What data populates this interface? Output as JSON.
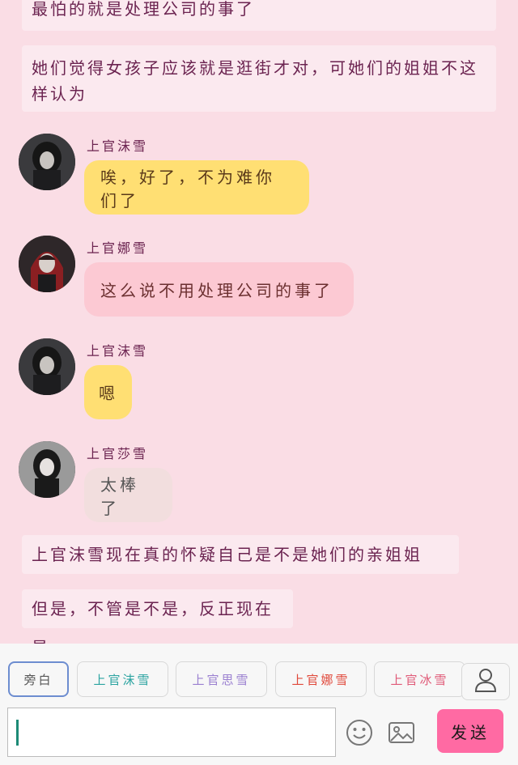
{
  "chat": {
    "narration_top_1": "最怕的就是处理公司的事了",
    "narration_top_2": "她们觉得女孩子应该就是逛街才对，可她们的姐姐不这样认为",
    "messages": [
      {
        "name": "上官沫雪",
        "text": "唉，好了，不为难你们了",
        "style": "yellow"
      },
      {
        "name": "上官娜雪",
        "text": "这么说不用处理公司的事了",
        "style": "pink"
      },
      {
        "name": "上官沫雪",
        "text": "嗯",
        "style": "yellow"
      },
      {
        "name": "上官莎雪",
        "text": "太棒了",
        "style": "beige"
      }
    ],
    "narration_bottom_1": "上官沫雪现在真的怀疑自己是不是她们的亲姐姐",
    "narration_bottom_2": "但是，不管是不是，反正现在是"
  },
  "toolbar": {
    "tabs": [
      {
        "label": "旁白",
        "color": "#555555"
      },
      {
        "label": "上官沫雪",
        "color": "#2aa3a0"
      },
      {
        "label": "上官思雪",
        "color": "#9a7fd0"
      },
      {
        "label": "上官娜雪",
        "color": "#e0483a"
      },
      {
        "label": "上官冰雪",
        "color": "#e05a78"
      }
    ],
    "send_label": "发送",
    "input_value": ""
  },
  "icons": {
    "user": "user-icon",
    "emoji": "emoji-icon",
    "image": "image-icon"
  },
  "colors": {
    "background": "#fadde5",
    "send_button": "#ff6aa3",
    "bubble_yellow": "#ffdf73",
    "bubble_pink": "#fcc9d3",
    "bubble_beige": "#f2dede"
  }
}
